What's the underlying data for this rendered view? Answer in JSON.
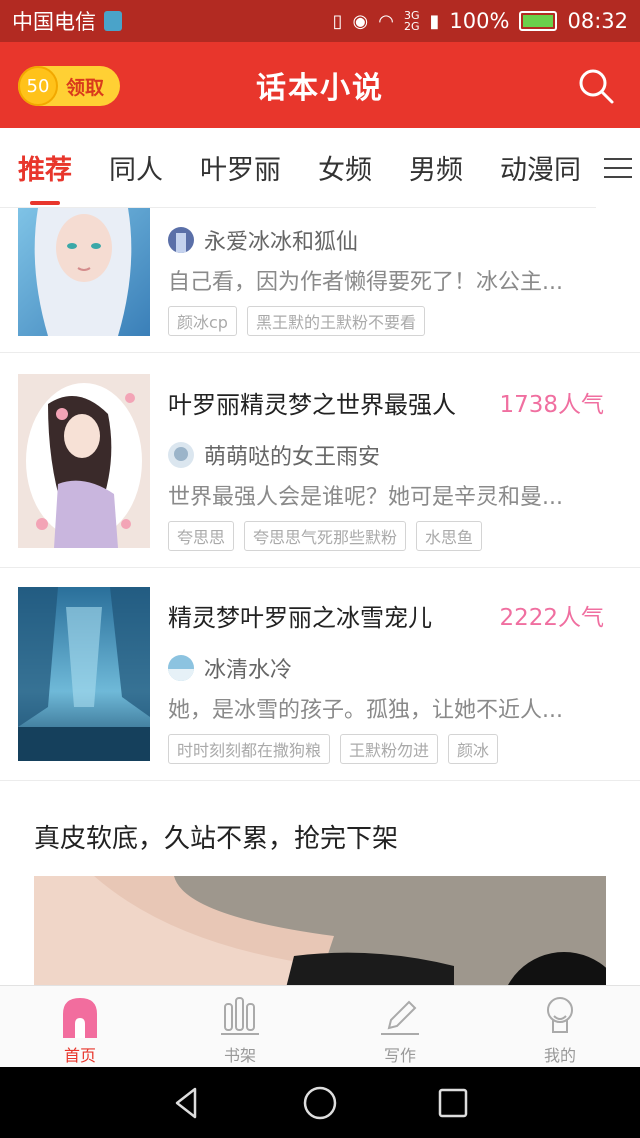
{
  "status_bar": {
    "carrier": "中国电信",
    "network_label_top": "3G",
    "network_label_bottom": "2G",
    "battery": "100%",
    "time": "08:32"
  },
  "header": {
    "coin_count": "50",
    "coin_label": "领取",
    "title": "话本小说"
  },
  "tabs": [
    {
      "label": "推荐",
      "active": true
    },
    {
      "label": "同人",
      "active": false
    },
    {
      "label": "叶罗丽",
      "active": false
    },
    {
      "label": "女频",
      "active": false
    },
    {
      "label": "男频",
      "active": false
    },
    {
      "label": "动漫同",
      "active": false
    }
  ],
  "books": [
    {
      "title": "",
      "popularity": "",
      "author": "永爱冰冰和狐仙",
      "summary": "自己看，因为作者懒得要死了！冰公主...",
      "tags": [
        "颜冰cp",
        "黑王默的王默粉不要看"
      ]
    },
    {
      "title": "叶罗丽精灵梦之世界最强人",
      "popularity": "1738人气",
      "author": "萌萌哒的女王雨安",
      "summary": "世界最强人会是谁呢？她可是辛灵和曼...",
      "tags": [
        "夸思思",
        "夸思思气死那些默粉",
        "水思鱼"
      ]
    },
    {
      "title": "精灵梦叶罗丽之冰雪宠儿",
      "popularity": "2222人气",
      "author": "冰清水冷",
      "summary": "她，是冰雪的孩子。孤独，让她不近人...",
      "tags": [
        "时时刻刻都在撒狗粮",
        "王默粉勿进",
        "颜冰"
      ]
    }
  ],
  "ad": {
    "title": "真皮软底，久站不累，抢完下架"
  },
  "bottom_nav": [
    {
      "label": "首页",
      "icon": "home-icon",
      "active": true
    },
    {
      "label": "书架",
      "icon": "bookshelf-icon",
      "active": false
    },
    {
      "label": "写作",
      "icon": "pencil-icon",
      "active": false
    },
    {
      "label": "我的",
      "icon": "profile-icon",
      "active": false
    }
  ],
  "colors": {
    "accent": "#e8362c",
    "status_bar": "#b22a22",
    "popularity": "#f06fa0"
  }
}
